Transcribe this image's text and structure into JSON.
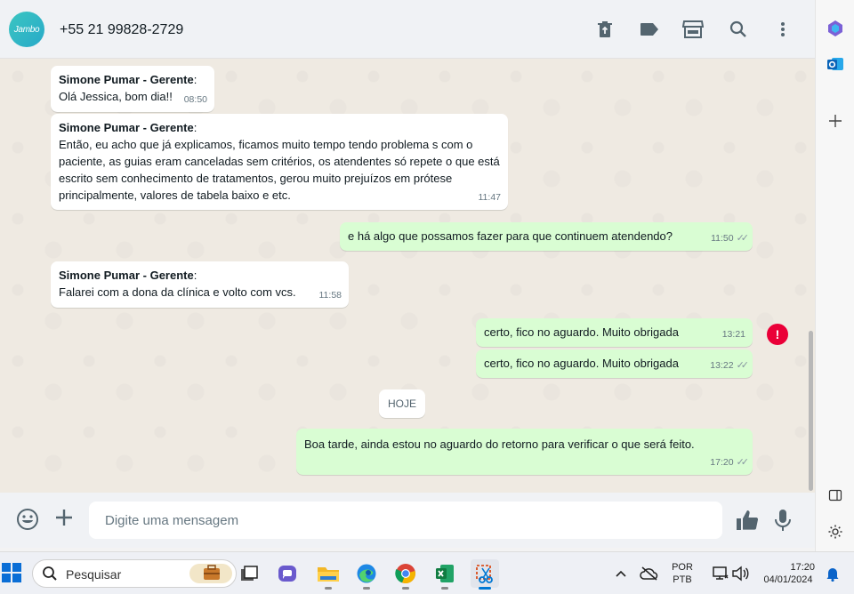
{
  "header": {
    "avatar_text": "Jambo",
    "contact": "+55 21 99828-2729",
    "icons": [
      "trash-icon",
      "label-icon",
      "store-icon",
      "search-icon",
      "more-vertical-icon"
    ]
  },
  "messages": [
    {
      "direction": "in",
      "sender": "Simone Pumar - Gerente",
      "colon": ":",
      "text": "Olá Jessica, bom dia!!",
      "time": "08:50"
    },
    {
      "direction": "in",
      "sender": "Simone Pumar - Gerente",
      "colon": ":",
      "text": "Então, eu acho que já explicamos, ficamos muito tempo tendo problema s com o paciente, as guias eram canceladas sem critérios, os atendentes só repete o que está escrito sem conhecimento de tratamentos, gerou muito prejuízos em prótese principalmente, valores de tabela baixo e etc.",
      "time": "11:47"
    },
    {
      "direction": "out",
      "text": "e há algo que possamos fazer para que continuem atendendo?",
      "time": "11:50",
      "status": "read"
    },
    {
      "direction": "in",
      "sender": "Simone Pumar - Gerente",
      "colon": ":",
      "text": "Falarei com a dona da clínica e volto com vcs.",
      "time": "11:58"
    },
    {
      "direction": "out",
      "text": "certo, fico no aguardo. Muito obrigada",
      "time": "13:21",
      "status": "failed"
    },
    {
      "direction": "out",
      "text": "certo, fico no aguardo. Muito obrigada",
      "time": "13:22",
      "status": "read"
    },
    {
      "direction": "out",
      "text": "Boa tarde, ainda estou no aguardo do retorno para verificar o que será feito.",
      "time": "17:20",
      "status": "read"
    }
  ],
  "date_chip": "HOJE",
  "error_glyph": "!",
  "composer": {
    "placeholder": "Digite uma mensagem"
  },
  "taskbar": {
    "search_label": "Pesquisar",
    "language_line1": "POR",
    "language_line2": "PTB",
    "clock_time": "17:20",
    "clock_date": "04/01/2024",
    "apps": [
      "widgets-briefcase",
      "task-view",
      "teams",
      "file-explorer",
      "edge",
      "chrome",
      "excel",
      "snipping-tool"
    ]
  },
  "colors": {
    "chat_bg": "#efeae2",
    "incoming_bubble": "#ffffff",
    "outgoing_bubble": "#d9fdd3",
    "error_red": "#ea0038",
    "avatar": "#34b7c4"
  }
}
